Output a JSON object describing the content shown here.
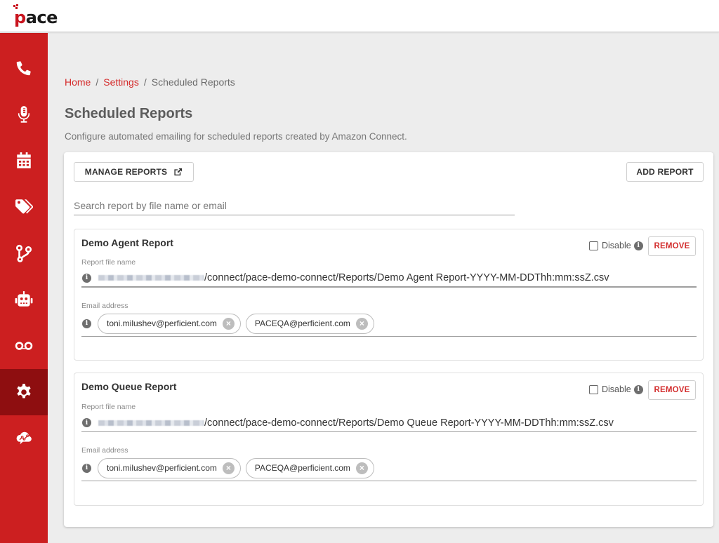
{
  "app": {
    "logo_text": "pace",
    "brand_color": "#cc1f20"
  },
  "sidebar": {
    "items": [
      {
        "name": "phone",
        "icon": "phone-icon",
        "active": false
      },
      {
        "name": "recording",
        "icon": "microphone-icon",
        "active": false
      },
      {
        "name": "calendar",
        "icon": "calendar-icon",
        "active": false
      },
      {
        "name": "tags",
        "icon": "tags-icon",
        "active": false
      },
      {
        "name": "routing",
        "icon": "code-branch-icon",
        "active": false
      },
      {
        "name": "bot",
        "icon": "robot-icon",
        "active": false
      },
      {
        "name": "voicemail",
        "icon": "voicemail-icon",
        "active": false
      },
      {
        "name": "settings",
        "icon": "gear-icon",
        "active": true
      },
      {
        "name": "analytics",
        "icon": "cloud-analytics-icon",
        "active": false
      }
    ]
  },
  "breadcrumb": {
    "home": "Home",
    "settings": "Settings",
    "current": "Scheduled Reports",
    "separator": "/"
  },
  "page": {
    "title": "Scheduled Reports",
    "description": "Configure automated emailing for scheduled reports created by Amazon Connect."
  },
  "toolbar": {
    "manage_label": "MANAGE REPORTS",
    "add_label": "ADD REPORT"
  },
  "search": {
    "placeholder": "Search report by file name or email",
    "value": ""
  },
  "labels": {
    "file_name": "Report file name",
    "email": "Email address",
    "disable": "Disable",
    "remove": "REMOVE",
    "info": "i",
    "chip_remove": "×"
  },
  "reports": [
    {
      "title": "Demo Agent Report",
      "disabled": false,
      "file_name_suffix": "/connect/pace-demo-connect/Reports/Demo Agent Report-YYYY-MM-DDThh:mm:ssZ.csv",
      "emails": [
        "toni.milushev@perficient.com",
        "PACEQA@perficient.com"
      ]
    },
    {
      "title": "Demo Queue Report",
      "disabled": false,
      "file_name_suffix": "/connect/pace-demo-connect/Reports/Demo Queue Report-YYYY-MM-DDThh:mm:ssZ.csv",
      "emails": [
        "toni.milushev@perficient.com",
        "PACEQA@perficient.com"
      ]
    }
  ]
}
